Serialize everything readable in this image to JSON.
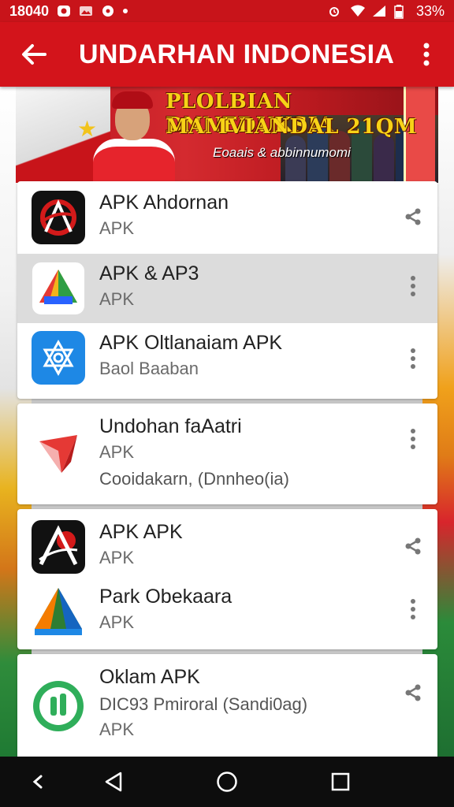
{
  "status_bar": {
    "time": "18040",
    "battery": "33%"
  },
  "app_bar": {
    "title": "UNDARHAN INDONESIA"
  },
  "banner": {
    "headline_1": "PLOLBIAN DNNEDUKSIA",
    "headline_2": "MAMVIANDAL 21QM",
    "tagline": "Eoaais & abbinnumomi"
  },
  "apps": [
    {
      "name": "APK Ahdornan",
      "sub": "APK",
      "action": "share-icon",
      "selected": false
    },
    {
      "name": "APK & AP3",
      "sub": "APK",
      "action": "more-icon",
      "selected": true
    },
    {
      "name": "APK Oltlanaiam APK",
      "sub": "Baol Baaban",
      "action": "more-icon",
      "selected": false
    },
    {
      "name": "Undohan faAatri",
      "sub": "APK",
      "extra": "Cooidakarn, (Dnnheo(ia)",
      "action": "more-icon",
      "selected": false
    },
    {
      "name": "APK APK",
      "sub": "APK",
      "action": "share-icon",
      "selected": false
    },
    {
      "name": "Park Obekaara",
      "sub": "APK",
      "action": "more-icon",
      "selected": false
    },
    {
      "name": "Oklam APK",
      "sub": "DIC93 Pmiroral (Sandi0ag)",
      "extra": "APK",
      "action": "share-icon",
      "selected": false
    }
  ],
  "colors": {
    "app_bar": "#d3141b",
    "status_bar": "#c8141a",
    "selected_row": "#dcdcdc"
  }
}
